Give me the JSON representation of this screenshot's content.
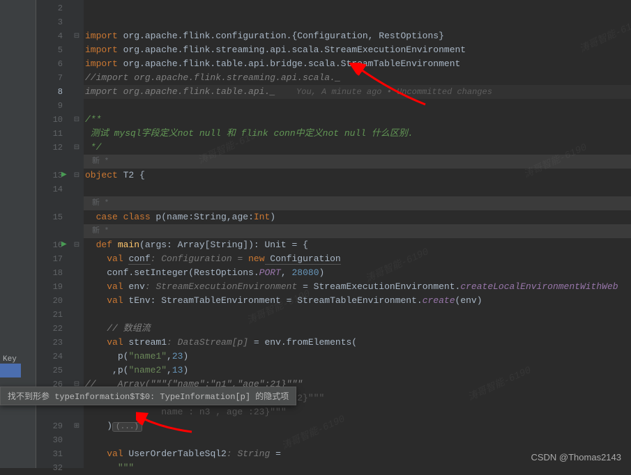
{
  "gutter": {
    "lines": [
      2,
      3,
      4,
      5,
      6,
      7,
      8,
      9,
      10,
      11,
      12,
      "",
      13,
      14,
      "",
      15,
      "",
      16,
      17,
      18,
      19,
      20,
      21,
      22,
      23,
      24,
      25,
      26,
      "",
      "",
      29,
      30,
      31,
      32
    ],
    "current": 8
  },
  "sidebar": {
    "tab": "Key"
  },
  "annotations": {
    "new": "新 *"
  },
  "code": {
    "l4_kw": "import",
    "l4_rest": " org.apache.flink.configuration.{Configuration, RestOptions}",
    "l5_kw": "import",
    "l5_rest": " org.apache.flink.streaming.api.scala.StreamExecutionEnvironment",
    "l6_kw": "import",
    "l6_rest": " org.apache.flink.table.api.bridge.scala.StreamTableEnvironment",
    "l7": "//import org.apache.flink.streaming.api.scala._",
    "l8": "import org.apache.flink.table.api._",
    "l8_lens": "You, A minute ago • Uncommitted changes",
    "l10": "/**",
    "l11_a": " 测试 ",
    "l11_b": "mysql字段定义not null",
    "l11_c": " 和 ",
    "l11_d": "flink conn中定义not null",
    "l11_e": " 什么区别.",
    "l12": " */",
    "l13_kw": "object",
    "l13_name": " T2 {",
    "l15_kw": "case class",
    "l15_a": " p(name:",
    "l15_t1": "String",
    "l15_b": ",age:",
    "l15_t2": "Int",
    "l15_c": ")",
    "l16_kw": "def ",
    "l16_fn": "main",
    "l16_a": "(args: Array[String]): ",
    "l16_t": "Unit",
    "l16_b": " = {",
    "l17_kw": "val ",
    "l17_v": "conf",
    "l17_a": ": Configuration = ",
    "l17_new": "new",
    "l17_b": " Configuration",
    "l18_a": "conf.setInteger(RestOptions.",
    "l18_p": "PORT",
    "l18_b": ", ",
    "l18_n": "28080",
    "l18_c": ")",
    "l19_kw": "val",
    "l19_a": " env",
    "l19_t": ": StreamExecutionEnvironment",
    "l19_b": " = StreamExecutionEnvironment.",
    "l19_m": "createLocalEnvironmentWithWeb",
    "l20_kw": "val",
    "l20_a": " tEnv: StreamTableEnvironment = StreamTableEnvironment.",
    "l20_m": "create",
    "l20_b": "(env)",
    "l22": "// 数组流",
    "l23_kw": "val",
    "l23_a": " stream1",
    "l23_t": ": DataStream[p]",
    "l23_b": " = env.fromElements(",
    "l24_a": "  p(",
    "l24_s": "\"name1\"",
    "l24_b": ",",
    "l24_n": "23",
    "l24_c": ")",
    "l25_a": " ,p(",
    "l25_s": "\"name2\"",
    "l25_b": ",",
    "l25_n": "13",
    "l25_c": ")",
    "l26": "//    Array(\"\"\"{\"name\":\"n1\",\"age\":21}\"\"\"",
    "l27_tail": "2}\"\"\"",
    "l28": "name : n3 , age :23}\"\"\"",
    "l29_a": ")",
    "l29_fold": "(...)",
    "l31_kw": "val",
    "l31_a": " UserOrderTableSql2",
    "l31_t": ": String",
    "l31_b": " =",
    "l32": "\"\"\""
  },
  "tooltip": "找不到形参 typeInformation$T$0: TypeInformation[p] 的隐式项",
  "watermark": "涛哥智能-6190",
  "csdn": "CSDN @Thomas2143"
}
